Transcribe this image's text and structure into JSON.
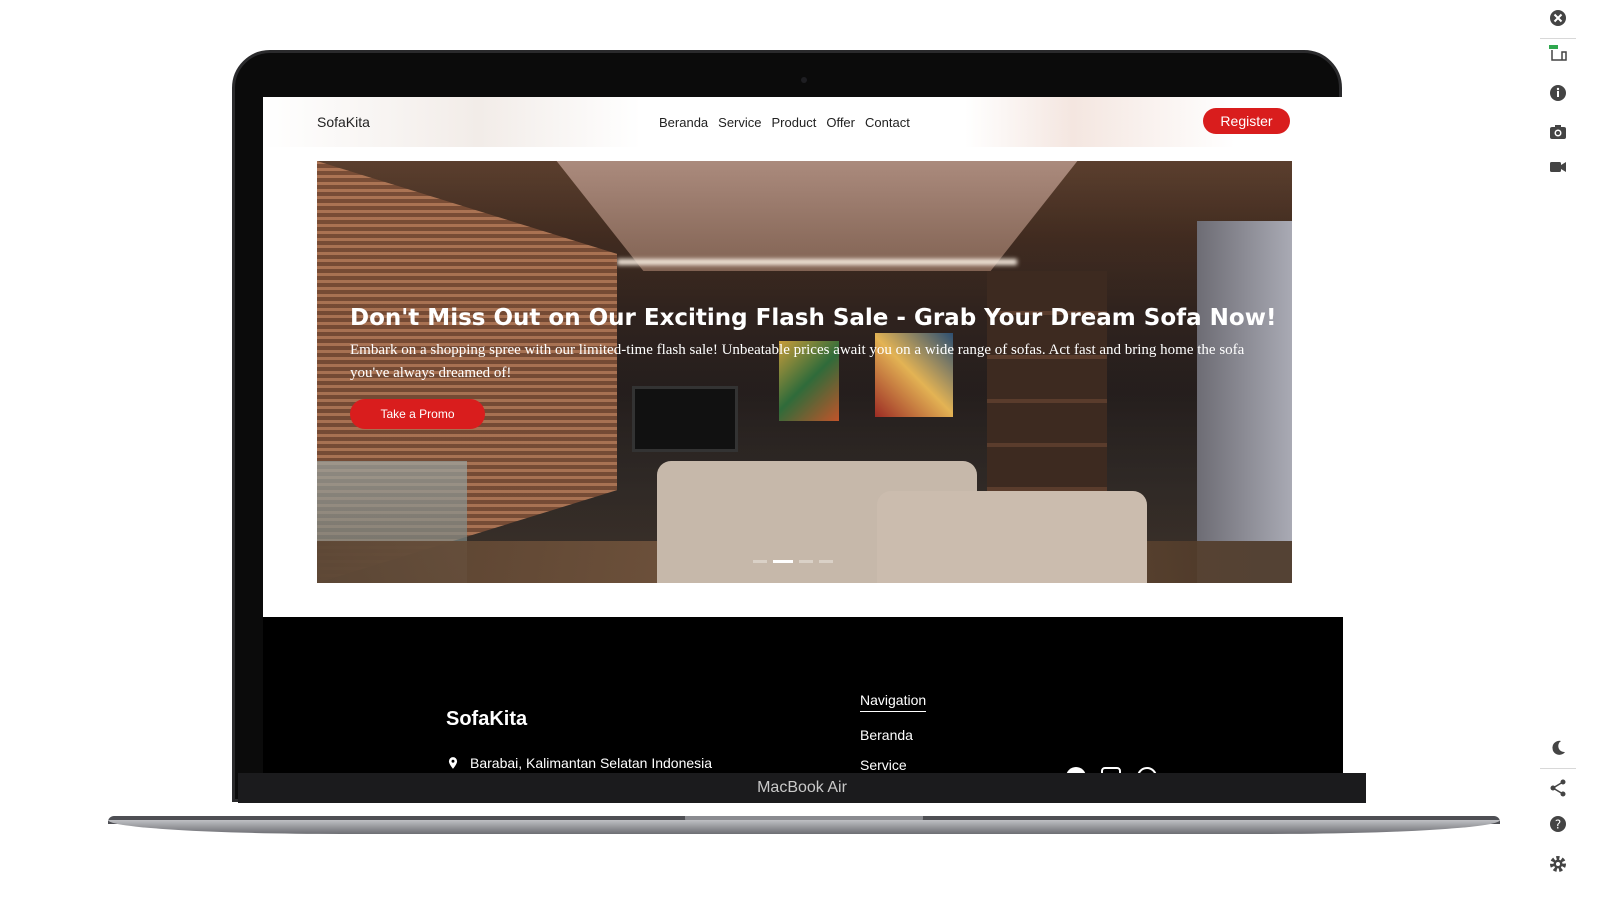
{
  "device": {
    "label": "MacBook Air"
  },
  "site": {
    "nav": {
      "logo": "SofaKita",
      "links": [
        "Beranda",
        "Service",
        "Product",
        "Offer",
        "Contact"
      ],
      "register_label": "Register"
    },
    "hero": {
      "title": "Don't Miss Out on Our Exciting Flash Sale - Grab Your Dream Sofa Now!",
      "description": "Embark on a shopping spree with our limited-time flash sale! Unbeatable prices await you on a wide range of sofas. Act fast and bring home the sofa you've always dreamed of!",
      "promo_label": "Take a Promo",
      "slides_count": 4,
      "active_slide": 2
    },
    "footer": {
      "logo": "SofaKita",
      "address": "Barabai, Kalimantan Selatan Indonesia",
      "nav_heading": "Navigation",
      "nav_items": [
        "Beranda",
        "Service"
      ]
    }
  },
  "rail": {
    "icons": [
      "close-icon",
      "responsive-devices-icon",
      "info-icon",
      "camera-icon",
      "video-icon",
      "moon-icon",
      "share-icon",
      "help-icon",
      "settings-icon"
    ]
  },
  "colors": {
    "accent": "#d91d1d",
    "footer_bg": "#000000"
  }
}
